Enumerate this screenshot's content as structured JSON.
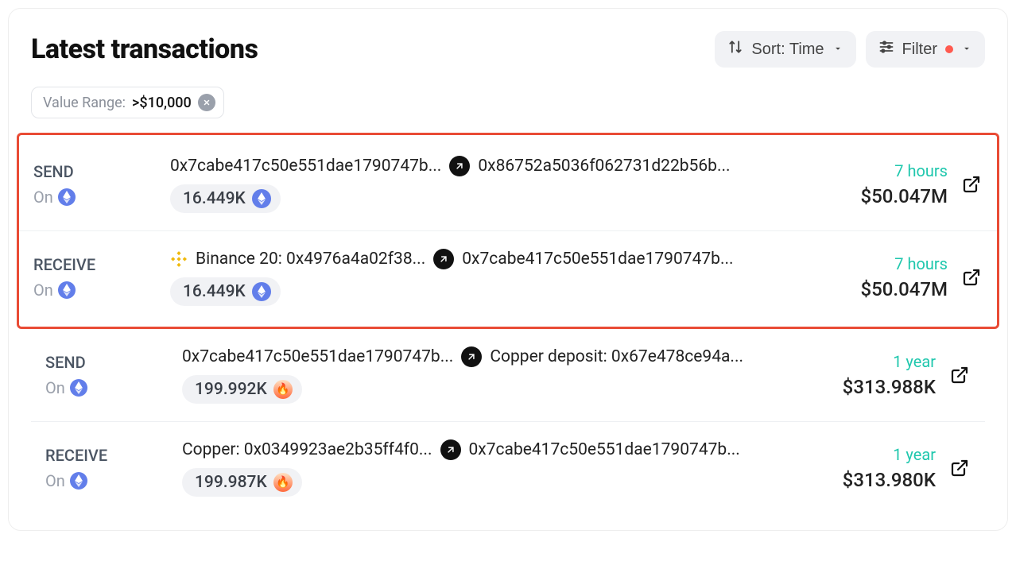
{
  "header": {
    "title": "Latest transactions",
    "sort_button": "Sort: Time",
    "filter_button": "Filter"
  },
  "filter_chip": {
    "label": "Value Range:",
    "value": ">$10,000"
  },
  "chain_label": "On",
  "transactions": [
    {
      "type": "SEND",
      "from": "0x7cabe417c50e551dae1790747b...",
      "to": "0x86752a5036f062731d22b56b...",
      "from_icon": null,
      "amount": "16.449K",
      "token": "eth",
      "time": "7 hours",
      "usd": "$50.047M"
    },
    {
      "type": "RECEIVE",
      "from": "Binance 20: 0x4976a4a02f38...",
      "to": "0x7cabe417c50e551dae1790747b...",
      "from_icon": "binance",
      "amount": "16.449K",
      "token": "eth",
      "time": "7 hours",
      "usd": "$50.047M"
    },
    {
      "type": "SEND",
      "from": "0x7cabe417c50e551dae1790747b...",
      "to": "Copper deposit: 0x67e478ce94a...",
      "from_icon": null,
      "amount": "199.992K",
      "token": "fire",
      "time": "1 year",
      "usd": "$313.988K"
    },
    {
      "type": "RECEIVE",
      "from": "Copper: 0x0349923ae2b35ff4f0...",
      "to": "0x7cabe417c50e551dae1790747b...",
      "from_icon": null,
      "amount": "199.987K",
      "token": "fire",
      "time": "1 year",
      "usd": "$313.980K"
    }
  ]
}
